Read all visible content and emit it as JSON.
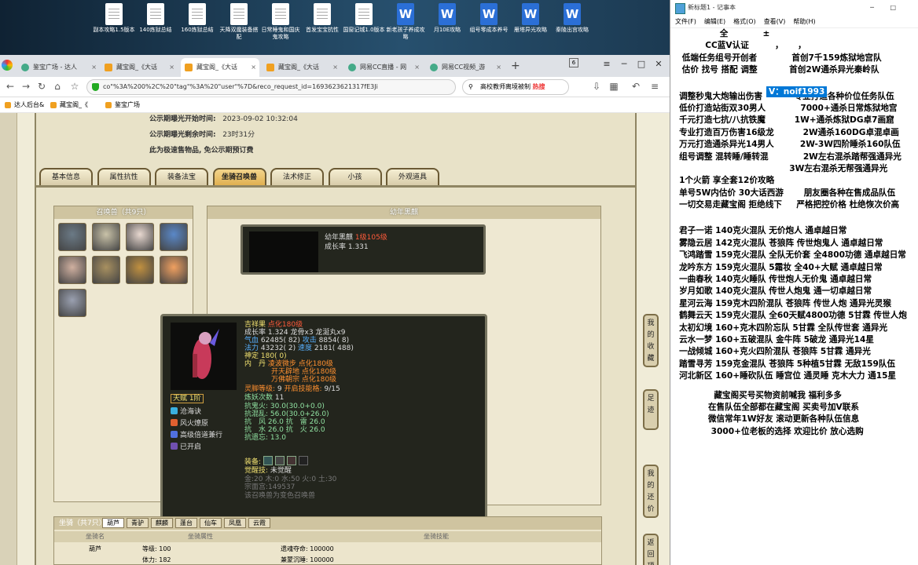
{
  "desktop": {
    "icons": [
      {
        "label": "副本攻略1.5版本",
        "kind": "doc"
      },
      {
        "label": "140炼狱总结",
        "kind": "doc"
      },
      {
        "label": "160炼狱总结",
        "kind": "doc"
      },
      {
        "label": "天降双魔装备搭配",
        "kind": "doc"
      },
      {
        "label": "日常睡鬼和国庆鬼攻略",
        "kind": "doc"
      },
      {
        "label": "首发宝宝抗性",
        "kind": "doc"
      },
      {
        "label": "国窗记城1.0版本",
        "kind": "doc"
      },
      {
        "label": "新老孩子养成攻略",
        "kind": "word"
      },
      {
        "label": "月10E攻略",
        "kind": "word"
      },
      {
        "label": "组号零成本养号",
        "kind": "word"
      },
      {
        "label": "雁塔异光攻略",
        "kind": "word"
      },
      {
        "label": "秦陵出宫攻略",
        "kind": "word"
      }
    ]
  },
  "browser": {
    "tabs": [
      {
        "label": "鉴宝广场 - 达人",
        "active": false
      },
      {
        "label": "藏宝阁_《大话",
        "active": false
      },
      {
        "label": "藏宝阁_《大话",
        "active": true
      },
      {
        "label": "藏宝阁_《大话",
        "active": false
      },
      {
        "label": "网易CC直播 - 网",
        "active": false
      },
      {
        "label": "网易CC视频_游",
        "active": false
      }
    ],
    "tab_count": "6",
    "url": "co\"%3A%200%2C%20\"tag\"%3A%20\"user\"%7D&reco_request_id=1693623621317fE3Ji",
    "search_text": "高校教师离境被制",
    "search_hot": "热搜",
    "bookmarks": [
      "达人后台&",
      "藏宝阁_《",
      "鉴宝广场"
    ]
  },
  "game": {
    "publish_start_label": "公示期曝光开始时间:",
    "publish_start_value": "2023-09-02 10:32:04",
    "publish_remain_label": "公示期曝光剩余时间:",
    "publish_remain_value": "23时31分",
    "fast_sell_note": "此为极速售物品, 免公示期预订费",
    "tabs": [
      "基本信息",
      "属性抗性",
      "装备法宝",
      "坐骑召唤兽",
      "法术修正",
      "小孩",
      "外观道具"
    ],
    "selected_tab": "坐骑召唤兽",
    "summons_title": "召唤兽（共9只）",
    "young_title": "幼年黑麒",
    "young_card": {
      "name": "幼年黑麒",
      "level": "1级105级",
      "growth": "成长率 1.331"
    },
    "tooltip": {
      "name": "吉祥果",
      "rank": "点化180级",
      "growth_line": "成长率 1.324  龙骨x3  龙涎丸x9",
      "hp_label": "气血",
      "hp_value": "62485( 82)",
      "atk_label": "攻击",
      "atk_value": "8854( 8)",
      "mp_label": "法力",
      "mp_value": "43232( 2)",
      "spd_label": "速度",
      "spd_value": "2181( 488)",
      "loyalty": "神定 180( 0)",
      "neidan_label": "内　丹",
      "neidan": [
        "凌波微步 点化180级",
        "开天辟地 点化180级",
        "万佛朝宗 点化180级"
      ],
      "soul_level": "灵脚等级:",
      "soul_value": "9",
      "soul_skill": "开启技能格:",
      "soul_skill_value": "9/15",
      "train_label": "炼妖次数",
      "train_value": "11",
      "resist1": "抗鬼火: 30.0(30.0+0.0)",
      "resist2": "抗混乱: 56.0(30.0+26.0)",
      "resist3": "抗　风 26.0  抗　雷 26.0",
      "resist4": "抗　水 26.0  抗　火 26.0",
      "resist5": "抗遗忘: 13.0",
      "talent_label": "天赋",
      "talent_level": "1阶",
      "skills": [
        "沧海诀",
        "风火燎原",
        "高级倍道兼行",
        "已开启"
      ],
      "equip_label": "装备:",
      "awaken_label": "觉醒技:",
      "awaken_value": "未觉醒",
      "elements": "金:20 木:0 水:50 火:0 土:30",
      "pet_id": "宗面宫:149537",
      "variant_note": "该召唤兽为变色召唤兽"
    },
    "mount_title": "坐骑（共7只）",
    "mount_tabs": [
      "葫芦",
      "青驴",
      "麒麟",
      "蓬台",
      "仙车",
      "凤凰",
      "云霞"
    ],
    "mount_headers": [
      "坐骑名",
      "坐骑属性",
      "坐骑技能"
    ],
    "mount_row": {
      "name": "葫芦",
      "level": "等级: 100",
      "stamina": "体力: 182",
      "skill1": "遗魂夺命: 100000",
      "skill2": "兼蒙沉睡: 100000"
    },
    "side_buttons": [
      "我的收藏",
      "足迹",
      "我的还价",
      "返回顶部"
    ]
  },
  "notepad": {
    "title": "新标题1 - 记事本",
    "menus": [
      "文件(F)",
      "编辑(E)",
      "格式(O)",
      "查看(V)",
      "帮助(H)"
    ],
    "lines": [
      "                 全            ±",
      "            CC蓝V认证         ，     ，",
      "    低端任务组号开创者            首创7千159炼狱地宫队",
      "    估价 找号 搭配 调整           首创2W通杀异光秦岭队",
      "",
      "",
      "   调整秒鬼大炮输出伤害           专业打造各种价位任务队伍",
      "   低价打造站街双30男人            7000+通杀日常炼狱地宫",
      "   千元打造七抗/八抗铁魔          1W+通杀炼狱DG卓7画窟",
      "   专业打造百万伤害16级龙          2W通杀160DG卓混卓画",
      "   万元打造通杀异光14男人         2W-3W四阶睡杀160队伍",
      "   组号调整 混转睡/睡转混            2W左右混杀踏帮强通异光",
      "                                         3W左右混杀无帮强通异光",
      "   1个火箭 享全套12价攻略",
      "   单号5W内估价 30大话西游       朋友圈各种在售成品队伍",
      "   一切交易走藏宝阁 拒绝线下     严格把控价格 杜绝恢次价高",
      "",
      "",
      "   君子一诺 140克火混队 无价炮人 通卓越日常",
      "   雾隐云居 142克火混队 苍狼阵 传世炮鬼人 通卓越日常",
      "   飞鸿踏雪 159克火混队 全队无价套 全4800功德 通卓越日常",
      "   龙吟东方 159克火混队 5霜妆 全40+大赋 通卓越日常",
      "   一曲春秋 140克火睡队 传世炮人无价鬼 通卓越日常",
      "   岁月如歌 140克火混队 传世人炮鬼 通一切卓越日常",
      "   星河云海 159克木四阶混队 苍狼阵 传世人炮 通异光灵猴",
      "   鹤舞云天 159克火混队 全60天赋4800功德 5甘霖 传世人炮",
      "   太初幻境 160+克木四阶忘队 5甘霖 全队传世套 通异光",
      "   云水一梦 160+五破混队 金牛阵 5破龙 通异光14星",
      "   一战倾城 160+克火四阶混队 苍狼阵 5甘霖 通异光",
      "   踏雪寻芳 159克金混队 苍狼阵 5种植5甘霖 无敌159队伍",
      "   河北新区 160+睡砍队伍 睡宫位 通灵睡 克木大力 通15星",
      "",
      "               藏宝阁买号买物资前喊我 福利多多",
      "             在售队伍全部都在藏宝阁 买卖号加V联系",
      "             微信常年1W好友 滚动更新各种队伍信息",
      "              3000+位老板的选择 欢迎比价 放心选购"
    ],
    "highlight": "V：noif1993"
  }
}
